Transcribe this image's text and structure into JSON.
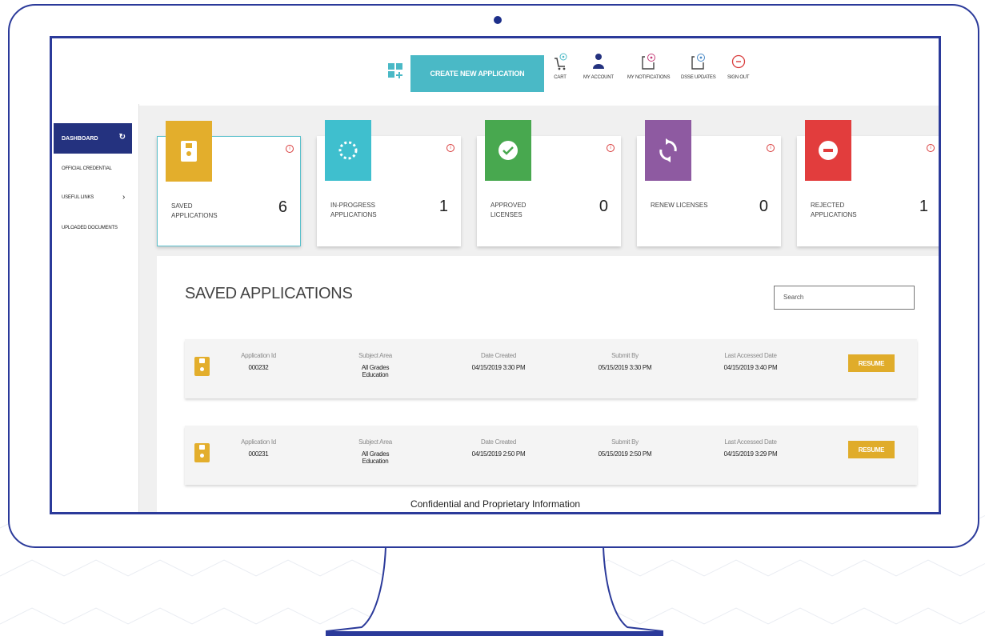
{
  "header": {
    "create_button": "CREATE NEW APPLICATION",
    "nav": [
      {
        "label": "CART",
        "icon": "cart-icon"
      },
      {
        "label": "MY ACCOUNT",
        "icon": "user-icon"
      },
      {
        "label": "MY NOTIFICATIONS",
        "icon": "notification-icon"
      },
      {
        "label": "DSSE UPDATES",
        "icon": "updates-icon"
      },
      {
        "label": "SIGN OUT",
        "icon": "sign-out-icon"
      }
    ]
  },
  "sidebar": {
    "active": "DASHBOARD",
    "items": [
      "OFFICIAL CREDENTIAL",
      "USEFUL LINKS",
      "UPLOADED DOCUMENTS"
    ]
  },
  "cards": [
    {
      "label": "SAVED APPLICATIONS",
      "count": "6",
      "color": "#e3ae2c",
      "icon": "save-icon"
    },
    {
      "label": "IN-PROGRESS APPLICATIONS",
      "count": "1",
      "color": "#3fbfce",
      "icon": "progress-icon"
    },
    {
      "label": "APPROVED LICENSES",
      "count": "0",
      "color": "#48a84f",
      "icon": "check-icon"
    },
    {
      "label": "RENEW LICENSES",
      "count": "0",
      "color": "#8e5aa1",
      "icon": "renew-icon"
    },
    {
      "label": "REJECTED APPLICATIONS",
      "count": "1",
      "color": "#e23d3d",
      "icon": "reject-icon"
    }
  ],
  "section": {
    "title": "SAVED APPLICATIONS",
    "search_placeholder": "Search"
  },
  "table": {
    "headers": [
      "Application Id",
      "Subject Area",
      "Date Created",
      "Submit By",
      "Last Accessed Date"
    ],
    "resume_label": "RESUME",
    "rows": [
      {
        "id": "000232",
        "subject": "All Grades Education",
        "created": "04/15/2019 3:30 PM",
        "submit_by": "05/15/2019 3:30 PM",
        "last_accessed": "04/15/2019 3:40 PM"
      },
      {
        "id": "000231",
        "subject": "All Grades Education",
        "created": "04/15/2019 2:50 PM",
        "submit_by": "05/15/2019 2:50 PM",
        "last_accessed": "04/15/2019 3:29 PM"
      }
    ]
  },
  "footer": {
    "confidential": "Confidential and Proprietary Information"
  }
}
